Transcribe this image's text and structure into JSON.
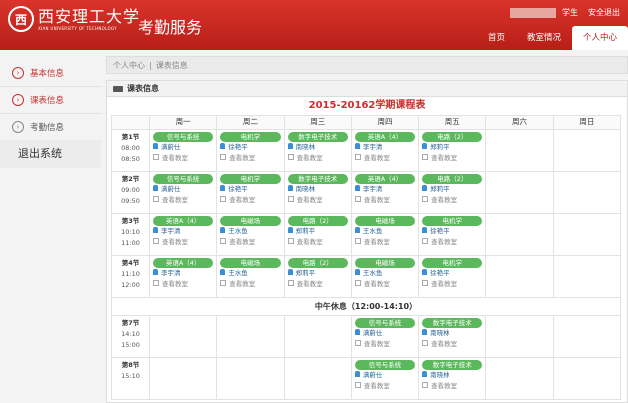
{
  "header": {
    "logo_mark": "西",
    "logo_cn": "西安理工大学",
    "logo_en": "XIAN UNIVERSITY OF TECHNOLOGY",
    "app_title": "考勤服务",
    "user_label": "学生",
    "logout": "安全退出",
    "nav": [
      "首页",
      "教室情况",
      "个人中心"
    ]
  },
  "sidebar": {
    "items": [
      "基本信息",
      "课表信息",
      "考勤信息"
    ],
    "exit": "退出系统"
  },
  "breadcrumb": [
    "个人中心",
    "课表信息"
  ],
  "panel": {
    "title": "课表信息",
    "schedule_title": "2015-20162学期课程表",
    "days": [
      "周一",
      "周二",
      "周三",
      "周四",
      "周五",
      "周六",
      "周日"
    ],
    "room_label": "查看教室",
    "lunch": "中午休息（12:00-14:10）"
  },
  "slots": [
    {
      "name": "第1节",
      "start": "08:00",
      "end": "08:50"
    },
    {
      "name": "第2节",
      "start": "09:00",
      "end": "09:50"
    },
    {
      "name": "第3节",
      "start": "10:10",
      "end": "11:00"
    },
    {
      "name": "第4节",
      "start": "11:10",
      "end": "12:00"
    },
    {
      "name": "第7节",
      "start": "14:10",
      "end": "15:00"
    },
    {
      "name": "第8节",
      "start": "15:10",
      "end": ""
    }
  ],
  "courses": {
    "0": {
      "0": {
        "course": "信号与系统",
        "teacher": "满蔚仕"
      },
      "1": {
        "course": "电机学",
        "teacher": "徐艳平"
      },
      "2": {
        "course": "数字电子技术",
        "teacher": "南晓林"
      },
      "3": {
        "course": "英语A（4）",
        "teacher": "李宇清"
      },
      "4": {
        "course": "电路（2）",
        "teacher": "郑莉平"
      }
    },
    "1": {
      "0": {
        "course": "信号与系统",
        "teacher": "满蔚仕"
      },
      "1": {
        "course": "电机学",
        "teacher": "徐艳平"
      },
      "2": {
        "course": "数字电子技术",
        "teacher": "南晓林"
      },
      "3": {
        "course": "英语A（4）",
        "teacher": "李宇清"
      },
      "4": {
        "course": "电路（2）",
        "teacher": "郑莉平"
      }
    },
    "2": {
      "0": {
        "course": "英语A（4）",
        "teacher": "李宇清"
      },
      "1": {
        "course": "电磁场",
        "teacher": "王水鱼"
      },
      "2": {
        "course": "电路（2）",
        "teacher": "郑莉平"
      },
      "3": {
        "course": "电磁场",
        "teacher": "王水鱼"
      },
      "4": {
        "course": "电机学",
        "teacher": "徐艳平"
      }
    },
    "3": {
      "0": {
        "course": "英语A（4）",
        "teacher": "李宇清"
      },
      "1": {
        "course": "电磁场",
        "teacher": "王水鱼"
      },
      "2": {
        "course": "电路（2）",
        "teacher": "郑莉平"
      },
      "3": {
        "course": "电磁场",
        "teacher": "王水鱼"
      },
      "4": {
        "course": "电机学",
        "teacher": "徐艳平"
      }
    },
    "4": {
      "3": {
        "course": "信号与系统",
        "teacher": "满蔚仕"
      },
      "4": {
        "course": "数字电子技术",
        "teacher": "南晓林"
      }
    },
    "5": {
      "3": {
        "course": "信号与系统",
        "teacher": "满蔚仕"
      },
      "4": {
        "course": "数字电子技术",
        "teacher": "南晓林"
      }
    }
  }
}
